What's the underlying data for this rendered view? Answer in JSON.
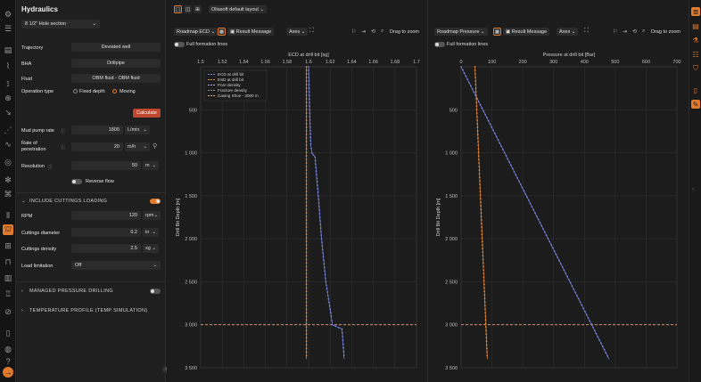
{
  "panel": {
    "title": "Hydraulics",
    "section_select": "8 1/2\" Hole section",
    "trajectory_label": "Trajectory",
    "trajectory_value": "Deviated well",
    "bha_label": "BHA",
    "bha_value": "Drillpipe",
    "fluid_label": "Fluid",
    "fluid_value": "OBM fluid - OBM fluid",
    "operation_label": "Operation type",
    "op_fixed": "Fixed depth",
    "op_moving": "Moving",
    "calculate": "Calculate",
    "pump_label": "Mud pump rate",
    "pump_value": "1800",
    "pump_unit": "L/min",
    "rop_label": "Rate of penetration",
    "rop_value": "20",
    "rop_unit": "m/h",
    "res_label": "Resolution",
    "res_value": "50",
    "res_unit": "m",
    "reverse_flow": "Reverse flow",
    "cuttings_section": "INCLUDE CUTTINGS LOADING",
    "rpm_label": "RPM",
    "rpm_value": "120",
    "rpm_unit": "rpm",
    "cdiam_label": "Cuttings diameter",
    "cdiam_value": "0.2",
    "cdiam_unit": "in",
    "cdens_label": "Cuttings density",
    "cdens_value": "2.5",
    "cdens_unit": "sg",
    "load_label": "Load limitation",
    "load_value": "Off",
    "mpd_section": "MANAGED PRESSURE DRILLING",
    "temp_section": "TEMPERATURE PROFILE (TEMP SIMULATION)"
  },
  "toolbar": {
    "layout": "Oliasoft default layout"
  },
  "left_chart": {
    "dropdown": "Roadmap ECD",
    "result_message": "Result Message",
    "axes": "Axes",
    "drag_zoom": "Drag to zoom",
    "full_formation": "Full formation lines"
  },
  "right_chart": {
    "dropdown": "Roadmap Pressure",
    "result_message": "Result Message",
    "axes": "Axes",
    "drag_zoom": "Drag to zoom",
    "full_formation": "Full formation lines"
  },
  "colors": {
    "accent": "#e07b2e",
    "ecd": "#7a86e0",
    "esd": "#e58a3c",
    "shoe": "#e8a07a"
  },
  "chart_data": [
    {
      "type": "line",
      "xlabel": "ECD at drill bit [sg]",
      "ylabel": "Drill Bit Depth [m]",
      "xlim": [
        1.5,
        1.7
      ],
      "ylim": [
        3500,
        0
      ],
      "x_ticks": [
        "1.5",
        "1.52",
        "1.54",
        "1.56",
        "1.58",
        "1.6",
        "1.62",
        "1.64",
        "1.66",
        "1.68",
        "1.7"
      ],
      "y_ticks": [
        "500",
        "1 000",
        "1 500",
        "2 000",
        "2 500",
        "3 000",
        "3 500"
      ],
      "legend": [
        "ECD at drill bit",
        "ESD at drill bit",
        "Pore density",
        "Fracture density",
        "Casing Shoe - 3000 m"
      ],
      "series": [
        {
          "name": "ECD at drill bit",
          "points": [
            [
              1.6,
              0
            ],
            [
              1.601,
              500
            ],
            [
              1.602,
              900
            ],
            [
              1.603,
              1000
            ],
            [
              1.606,
              1050
            ],
            [
              1.609,
              1500
            ],
            [
              1.612,
              2000
            ],
            [
              1.616,
              2500
            ],
            [
              1.621,
              2900
            ],
            [
              1.622,
              3000
            ],
            [
              1.631,
              3050
            ],
            [
              1.633,
              3400
            ]
          ]
        },
        {
          "name": "ESD at drill bit",
          "points": [
            [
              1.598,
              0
            ],
            [
              1.598,
              3400
            ]
          ]
        }
      ],
      "casing_shoe_depth": 3000
    },
    {
      "type": "line",
      "xlabel": "Pressure at drill bit [Bar]",
      "ylabel": "Drill Bit Depth [m]",
      "xlim": [
        0,
        700
      ],
      "ylim": [
        3500,
        0
      ],
      "x_ticks": [
        "0",
        "100",
        "200",
        "300",
        "400",
        "500",
        "600",
        "700"
      ],
      "y_ticks": [
        "500",
        "1 000",
        "1 500",
        "2 000",
        "2 500",
        "3 000",
        "3 500"
      ],
      "series": [
        {
          "name": "ECD at drill bit",
          "points": [
            [
              0,
              0
            ],
            [
              480,
              3400
            ]
          ]
        },
        {
          "name": "ESD at drill bit",
          "points": [
            [
              45,
              0
            ],
            [
              85,
              3400
            ]
          ]
        }
      ],
      "casing_shoe_depth": 3000
    }
  ]
}
